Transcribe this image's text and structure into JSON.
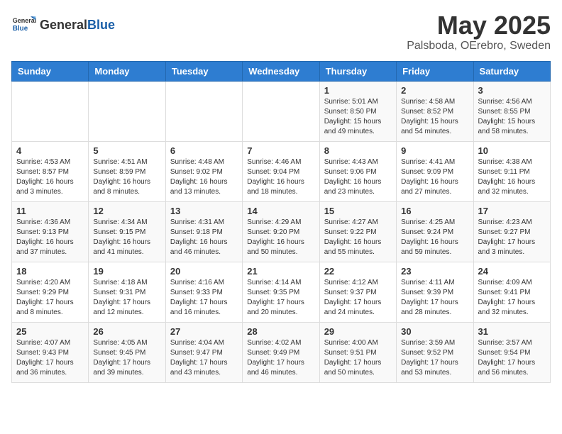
{
  "logo": {
    "general": "General",
    "blue": "Blue"
  },
  "title": {
    "month": "May 2025",
    "location": "Palsboda, OErebro, Sweden"
  },
  "headers": [
    "Sunday",
    "Monday",
    "Tuesday",
    "Wednesday",
    "Thursday",
    "Friday",
    "Saturday"
  ],
  "weeks": [
    [
      {
        "day": "",
        "info": ""
      },
      {
        "day": "",
        "info": ""
      },
      {
        "day": "",
        "info": ""
      },
      {
        "day": "",
        "info": ""
      },
      {
        "day": "1",
        "info": "Sunrise: 5:01 AM\nSunset: 8:50 PM\nDaylight: 15 hours\nand 49 minutes."
      },
      {
        "day": "2",
        "info": "Sunrise: 4:58 AM\nSunset: 8:52 PM\nDaylight: 15 hours\nand 54 minutes."
      },
      {
        "day": "3",
        "info": "Sunrise: 4:56 AM\nSunset: 8:55 PM\nDaylight: 15 hours\nand 58 minutes."
      }
    ],
    [
      {
        "day": "4",
        "info": "Sunrise: 4:53 AM\nSunset: 8:57 PM\nDaylight: 16 hours\nand 3 minutes."
      },
      {
        "day": "5",
        "info": "Sunrise: 4:51 AM\nSunset: 8:59 PM\nDaylight: 16 hours\nand 8 minutes."
      },
      {
        "day": "6",
        "info": "Sunrise: 4:48 AM\nSunset: 9:02 PM\nDaylight: 16 hours\nand 13 minutes."
      },
      {
        "day": "7",
        "info": "Sunrise: 4:46 AM\nSunset: 9:04 PM\nDaylight: 16 hours\nand 18 minutes."
      },
      {
        "day": "8",
        "info": "Sunrise: 4:43 AM\nSunset: 9:06 PM\nDaylight: 16 hours\nand 23 minutes."
      },
      {
        "day": "9",
        "info": "Sunrise: 4:41 AM\nSunset: 9:09 PM\nDaylight: 16 hours\nand 27 minutes."
      },
      {
        "day": "10",
        "info": "Sunrise: 4:38 AM\nSunset: 9:11 PM\nDaylight: 16 hours\nand 32 minutes."
      }
    ],
    [
      {
        "day": "11",
        "info": "Sunrise: 4:36 AM\nSunset: 9:13 PM\nDaylight: 16 hours\nand 37 minutes."
      },
      {
        "day": "12",
        "info": "Sunrise: 4:34 AM\nSunset: 9:15 PM\nDaylight: 16 hours\nand 41 minutes."
      },
      {
        "day": "13",
        "info": "Sunrise: 4:31 AM\nSunset: 9:18 PM\nDaylight: 16 hours\nand 46 minutes."
      },
      {
        "day": "14",
        "info": "Sunrise: 4:29 AM\nSunset: 9:20 PM\nDaylight: 16 hours\nand 50 minutes."
      },
      {
        "day": "15",
        "info": "Sunrise: 4:27 AM\nSunset: 9:22 PM\nDaylight: 16 hours\nand 55 minutes."
      },
      {
        "day": "16",
        "info": "Sunrise: 4:25 AM\nSunset: 9:24 PM\nDaylight: 16 hours\nand 59 minutes."
      },
      {
        "day": "17",
        "info": "Sunrise: 4:23 AM\nSunset: 9:27 PM\nDaylight: 17 hours\nand 3 minutes."
      }
    ],
    [
      {
        "day": "18",
        "info": "Sunrise: 4:20 AM\nSunset: 9:29 PM\nDaylight: 17 hours\nand 8 minutes."
      },
      {
        "day": "19",
        "info": "Sunrise: 4:18 AM\nSunset: 9:31 PM\nDaylight: 17 hours\nand 12 minutes."
      },
      {
        "day": "20",
        "info": "Sunrise: 4:16 AM\nSunset: 9:33 PM\nDaylight: 17 hours\nand 16 minutes."
      },
      {
        "day": "21",
        "info": "Sunrise: 4:14 AM\nSunset: 9:35 PM\nDaylight: 17 hours\nand 20 minutes."
      },
      {
        "day": "22",
        "info": "Sunrise: 4:12 AM\nSunset: 9:37 PM\nDaylight: 17 hours\nand 24 minutes."
      },
      {
        "day": "23",
        "info": "Sunrise: 4:11 AM\nSunset: 9:39 PM\nDaylight: 17 hours\nand 28 minutes."
      },
      {
        "day": "24",
        "info": "Sunrise: 4:09 AM\nSunset: 9:41 PM\nDaylight: 17 hours\nand 32 minutes."
      }
    ],
    [
      {
        "day": "25",
        "info": "Sunrise: 4:07 AM\nSunset: 9:43 PM\nDaylight: 17 hours\nand 36 minutes."
      },
      {
        "day": "26",
        "info": "Sunrise: 4:05 AM\nSunset: 9:45 PM\nDaylight: 17 hours\nand 39 minutes."
      },
      {
        "day": "27",
        "info": "Sunrise: 4:04 AM\nSunset: 9:47 PM\nDaylight: 17 hours\nand 43 minutes."
      },
      {
        "day": "28",
        "info": "Sunrise: 4:02 AM\nSunset: 9:49 PM\nDaylight: 17 hours\nand 46 minutes."
      },
      {
        "day": "29",
        "info": "Sunrise: 4:00 AM\nSunset: 9:51 PM\nDaylight: 17 hours\nand 50 minutes."
      },
      {
        "day": "30",
        "info": "Sunrise: 3:59 AM\nSunset: 9:52 PM\nDaylight: 17 hours\nand 53 minutes."
      },
      {
        "day": "31",
        "info": "Sunrise: 3:57 AM\nSunset: 9:54 PM\nDaylight: 17 hours\nand 56 minutes."
      }
    ]
  ]
}
